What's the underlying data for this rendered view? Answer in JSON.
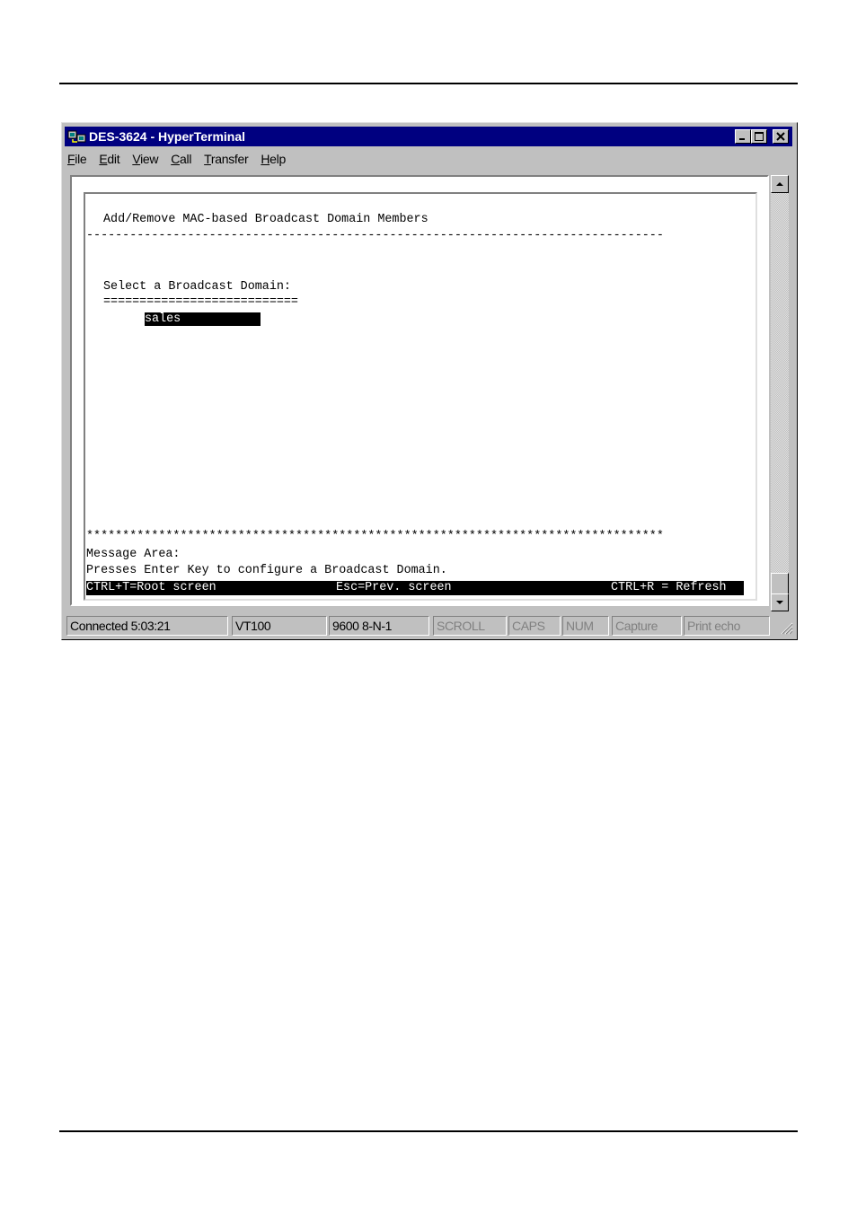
{
  "window": {
    "title": "DES-3624 - HyperTerminal",
    "icon": "hyperterminal-icon",
    "controls": [
      "minimize-icon",
      "maximize-icon",
      "close-icon"
    ]
  },
  "menu": [
    {
      "accel": "F",
      "rest": "ile"
    },
    {
      "accel": "E",
      "rest": "dit"
    },
    {
      "accel": "V",
      "rest": "iew"
    },
    {
      "accel": "C",
      "rest": "all"
    },
    {
      "accel": "T",
      "rest": "ransfer"
    },
    {
      "accel": "H",
      "rest": "elp"
    }
  ],
  "terminal": {
    "heading": "Add/Remove MAC-based Broadcast Domain Members",
    "dash_rule": "--------------------------------------------------------------------------------",
    "prompt": "Select a Broadcast Domain:",
    "eq_rule": "===========================",
    "selected_domain": "sales           ",
    "star_rule": "********************************************************************************",
    "message_label": "Message Area:",
    "message": "Presses Enter Key to configure a Broadcast Domain.",
    "footer_left": "CTRL+T=Root screen",
    "footer_mid": "Esc=Prev. screen",
    "footer_right": "CTRL+R = Refresh"
  },
  "status": {
    "connected": "Connected 5:03:21",
    "emulation": "VT100",
    "settings": "9600 8-N-1",
    "scroll": "SCROLL",
    "caps": "CAPS",
    "num": "NUM",
    "capture": "Capture",
    "print_echo": "Print echo"
  }
}
